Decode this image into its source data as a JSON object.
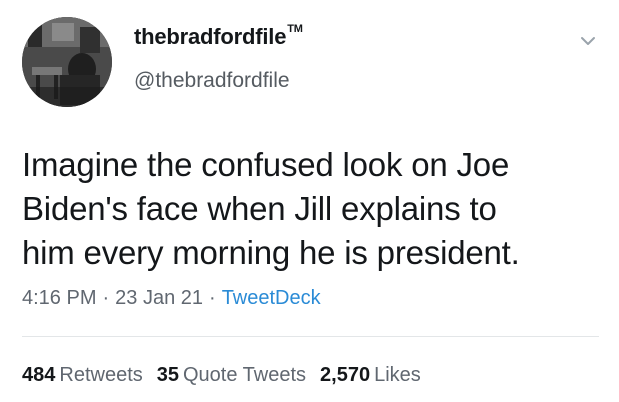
{
  "user": {
    "display_name": "thebradfordfile",
    "trademark": "TM",
    "handle": "@thebradfordfile",
    "avatar_icon": "profile-photo"
  },
  "menu": {
    "icon": "chevron-down-icon"
  },
  "tweet": {
    "text_line1": "Imagine the confused look on Joe",
    "text_line2": "Biden's face when Jill explains to",
    "text_line3": "him every morning he is president."
  },
  "meta": {
    "time": "4:16 PM",
    "separator": "·",
    "date": "23 Jan 21",
    "source": "TweetDeck"
  },
  "stats": {
    "retweets_count": "484",
    "retweets_label": "Retweets",
    "quotes_count": "35",
    "quotes_label": "Quote Tweets",
    "likes_count": "2,570",
    "likes_label": "Likes"
  },
  "colors": {
    "text": "#14171a",
    "secondary": "#606770",
    "link": "#2a8bd6",
    "divider": "#e3e6e8"
  }
}
